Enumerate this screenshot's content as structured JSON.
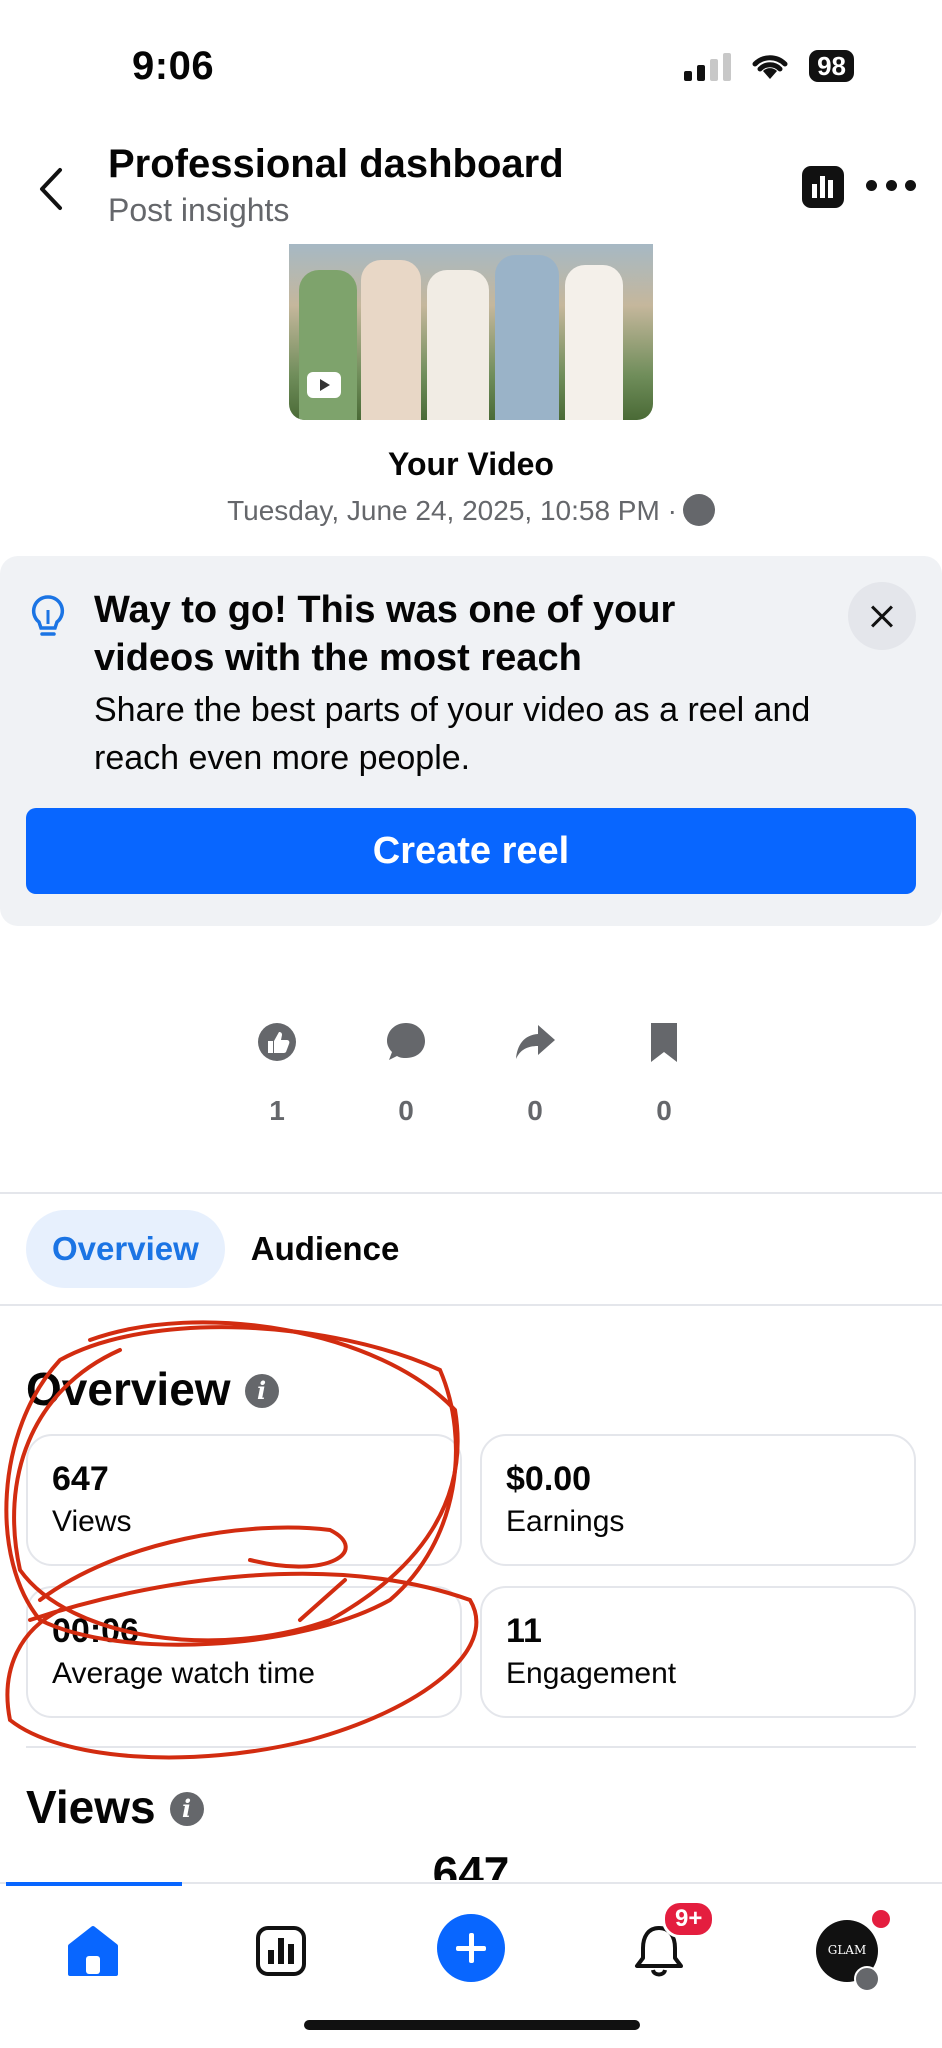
{
  "status_bar": {
    "time": "9:06",
    "battery": "98"
  },
  "header": {
    "title": "Professional dashboard",
    "subtitle": "Post insights"
  },
  "video": {
    "title": "Your Video",
    "date": "Tuesday, June 24, 2025, 10:58 PM ·"
  },
  "promo": {
    "title": "Way to go! This was one of your videos with the most reach",
    "body": "Share the best parts of your video as a reel and reach even more people.",
    "button": "Create reel"
  },
  "reactions": [
    {
      "icon": "like-icon",
      "count": "1"
    },
    {
      "icon": "comment-icon",
      "count": "0"
    },
    {
      "icon": "share-icon",
      "count": "0"
    },
    {
      "icon": "save-icon",
      "count": "0"
    }
  ],
  "tabs": {
    "overview": "Overview",
    "audience": "Audience"
  },
  "overview": {
    "title": "Overview",
    "metrics": [
      {
        "value": "647",
        "label": "Views"
      },
      {
        "value": "$0.00",
        "label": "Earnings"
      },
      {
        "value": "00:06",
        "label": "Average watch time"
      },
      {
        "value": "11",
        "label": "Engagement"
      }
    ]
  },
  "views_section": {
    "title": "Views",
    "value": "647"
  },
  "bottom_nav": {
    "notification_badge": "9+",
    "avatar_text": "GLAM"
  },
  "colors": {
    "accent": "#0866ff",
    "annotation": "#d22c10",
    "badge": "#e41e3f"
  }
}
